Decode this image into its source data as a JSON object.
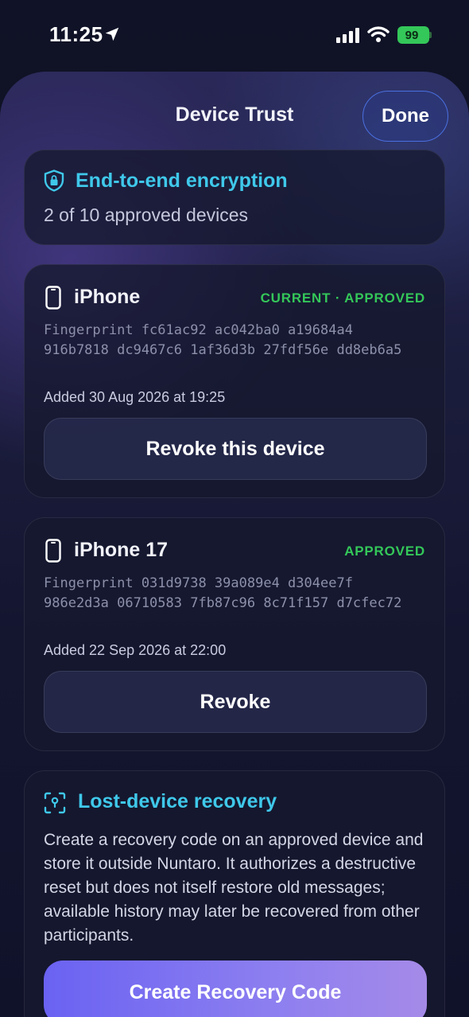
{
  "status_bar": {
    "time": "11:25",
    "battery": "99",
    "icons": [
      "location-arrow-icon",
      "cellular-signal-icon",
      "wifi-icon",
      "battery-icon"
    ]
  },
  "header": {
    "title": "Device Trust",
    "done_label": "Done"
  },
  "encryption": {
    "icon": "shield-lock-icon",
    "title": "End-to-end encryption",
    "subtitle": "2 of 10 approved devices"
  },
  "devices": [
    {
      "icon": "phone-icon",
      "name": "iPhone",
      "status": "CURRENT · APPROVED",
      "fingerprint": "Fingerprint fc61ac92 ac042ba0 a19684a4 916b7818 dc9467c6 1af36d3b 27fdf56e dd8eb6a5",
      "added": "Added 30 Aug 2026 at 19:25",
      "button": "Revoke this device"
    },
    {
      "icon": "phone-icon",
      "name": "iPhone 17",
      "status": "APPROVED",
      "fingerprint": "Fingerprint 031d9738 39a089e4 d304ee7f 986e2d3a 06710583 7fb87c96 8c71f157 d7cfec72",
      "added": "Added 22 Sep 2026 at 22:00",
      "button": "Revoke"
    }
  ],
  "recovery": {
    "icon": "scan-lock-icon",
    "title": "Lost-device recovery",
    "body": "Create a recovery code on an approved device and store it outside Nuntaro. It authorizes a destructive reset but does not itself restore old messages; available history may later be recovered from other participants.",
    "button": "Create Recovery Code"
  },
  "colors": {
    "accent_cyan": "#3fc8ea",
    "approved_green": "#34c759",
    "primary_gradient_start": "#6a62f2",
    "primary_gradient_end": "#a58ae8"
  }
}
